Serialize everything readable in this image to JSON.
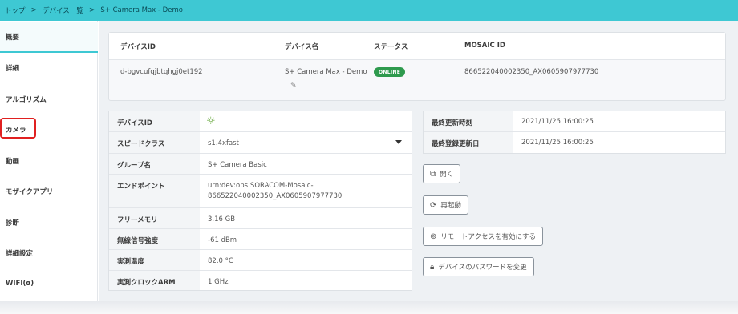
{
  "breadcrumb": {
    "top": "トップ",
    "list": "デバイス一覧",
    "current": "S+ Camera Max - Demo"
  },
  "sidebar": {
    "items": [
      {
        "label": "概要"
      },
      {
        "label": "詳細"
      },
      {
        "label": "アルゴリズム"
      },
      {
        "label": "カメラ"
      },
      {
        "label": "動画"
      },
      {
        "label": "モザイクアプリ"
      },
      {
        "label": "診断"
      },
      {
        "label": "詳細設定"
      },
      {
        "label": "WIFI(α)"
      }
    ]
  },
  "summary": {
    "headers": {
      "device_id": "デバイスID",
      "device_name": "デバイス名",
      "status": "ステータス",
      "mosaic_id": "MOSAIC ID"
    },
    "values": {
      "device_id": "d-bgvcufqjbtqhgj0et192",
      "device_name": "S+ Camera Max - Demo",
      "status": "ONLINE",
      "mosaic_id": "866522040002350_AX0605907977730"
    }
  },
  "info": [
    {
      "label": "デバイスID",
      "value": ""
    },
    {
      "label": "スピードクラス",
      "value": "s1.4xfast"
    },
    {
      "label": "グループ名",
      "value": "S+ Camera Basic"
    },
    {
      "label": "エンドポイント",
      "value": "urn:dev:ops:SORACOM-Mosaic-",
      "value2": "866522040002350_AX0605907977730"
    },
    {
      "label": "フリーメモリ",
      "value": "3.16 GB"
    },
    {
      "label": "無線信号強度",
      "value": "-61 dBm"
    },
    {
      "label": "実測温度",
      "value": "82.0 °C"
    },
    {
      "label": "実測クロックARM",
      "value": "1 GHz"
    }
  ],
  "status": [
    {
      "label": "最終更新時刻",
      "value": "2021/11/25 16:00:25"
    },
    {
      "label": "最終登録更新日",
      "value": "2021/11/25 16:00:25"
    }
  ],
  "buttons": {
    "open": "開く",
    "restart": "再起動",
    "remote_access": "リモートアクセスを有効にする",
    "change_password": "デバイスのパスワードを変更"
  },
  "icons": {
    "gear": "gear-icon",
    "pencil": "pencil-icon",
    "external": "external-link-icon",
    "restart": "restart-icon",
    "remote": "remote-access-icon",
    "lock": "lock-icon"
  },
  "colors": {
    "topbar": "#3ec8d3",
    "online": "#2e9a4d",
    "highlight": "#e02020"
  }
}
